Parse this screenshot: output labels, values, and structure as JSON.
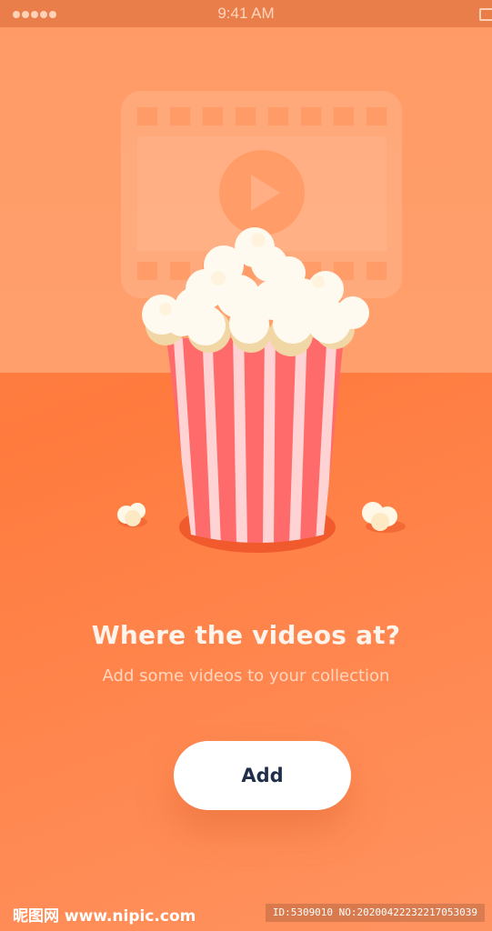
{
  "status_bar": {
    "time": "9:41 AM",
    "signal_icon": "signal-dots-icon",
    "battery_icon": "battery-icon"
  },
  "illustration": {
    "background_icon": "film-strip-play-icon",
    "foreground_icon": "popcorn-bucket-icon"
  },
  "empty_state": {
    "title": "Where the videos at?",
    "subtitle": "Add some videos to your collection",
    "button_label": "Add"
  },
  "watermark": {
    "left": "昵图网 www.nipic.com",
    "right": "ID:5309010 NO:20200422232217053039"
  },
  "colors": {
    "background": "#ff8a55",
    "button": "#ffffff",
    "button_text": "#1f2f4a",
    "stripe_red": "#ff6b6b",
    "stripe_light": "#ffd0d0"
  }
}
